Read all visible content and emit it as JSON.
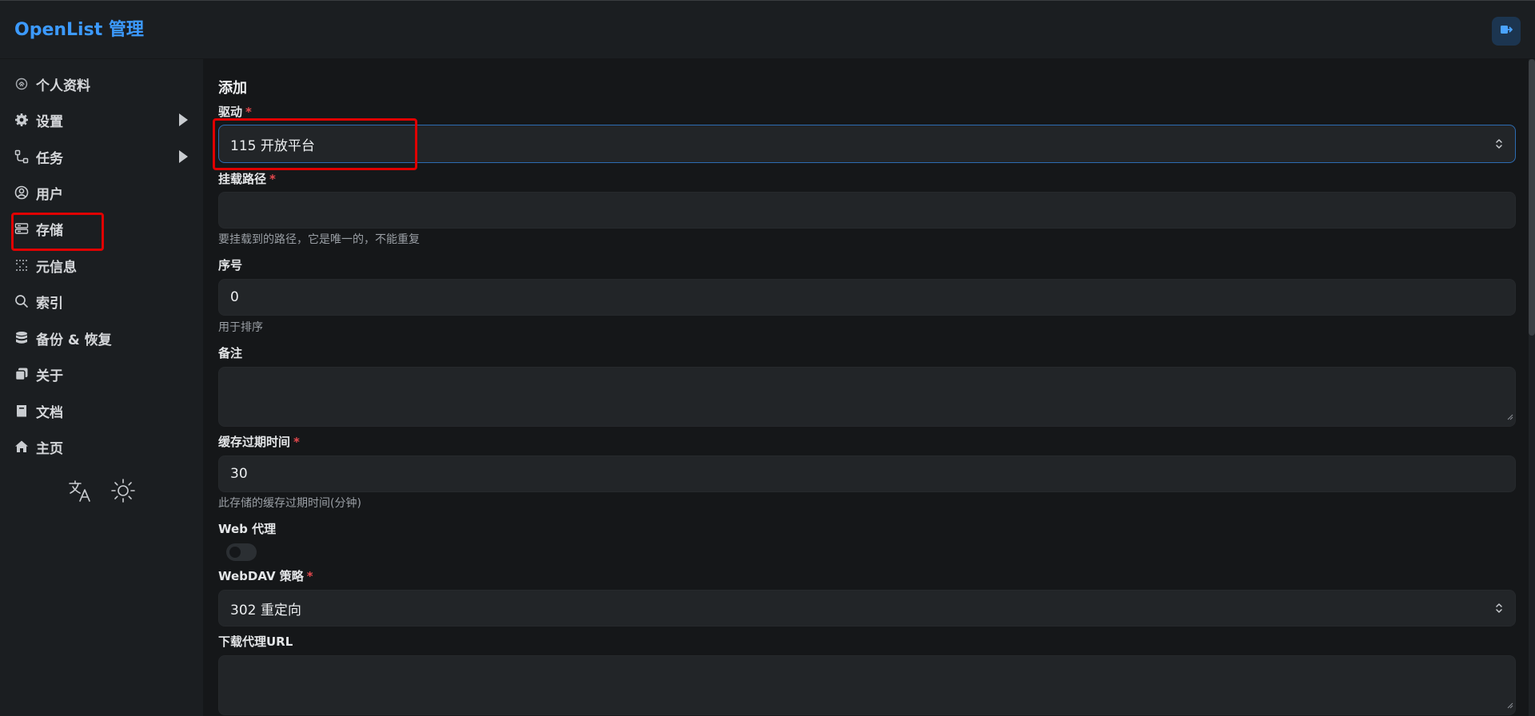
{
  "app": {
    "title": "OpenList 管理"
  },
  "sidebar": {
    "items": [
      {
        "label": "个人资料",
        "icon": "fingerprint-icon"
      },
      {
        "label": "设置",
        "icon": "gear-icon",
        "expandable": true
      },
      {
        "label": "任务",
        "icon": "flow-icon",
        "expandable": true
      },
      {
        "label": "用户",
        "icon": "user-circle-icon"
      },
      {
        "label": "存储",
        "icon": "storage-icon",
        "active": true
      },
      {
        "label": "元信息",
        "icon": "grid-icon"
      },
      {
        "label": "索引",
        "icon": "search-icon"
      },
      {
        "label": "备份 & 恢复",
        "icon": "database-icon"
      },
      {
        "label": "关于",
        "icon": "copy-icon"
      },
      {
        "label": "文档",
        "icon": "book-icon"
      },
      {
        "label": "主页",
        "icon": "home-icon"
      }
    ],
    "tools": [
      "translate-icon",
      "sun-icon"
    ]
  },
  "form": {
    "title": "添加",
    "driver": {
      "label": "驱动",
      "required": "*",
      "value": "115 开放平台"
    },
    "mount_path": {
      "label": "挂载路径",
      "required": "*",
      "value": "",
      "help": "要挂载到的路径，它是唯一的，不能重复"
    },
    "order": {
      "label": "序号",
      "value": "0",
      "help": "用于排序"
    },
    "remark": {
      "label": "备注",
      "value": ""
    },
    "cache_expiration": {
      "label": "缓存过期时间",
      "required": "*",
      "value": "30",
      "help": "此存储的缓存过期时间(分钟)"
    },
    "web_proxy": {
      "label": "Web 代理",
      "enabled": false
    },
    "webdav_policy": {
      "label": "WebDAV 策略",
      "required": "*",
      "value": "302 重定向"
    },
    "download_proxy_url": {
      "label": "下载代理URL",
      "value": ""
    }
  },
  "colors": {
    "accent": "#3c9aff",
    "highlight": "#e00000",
    "required": "#e5484d"
  }
}
